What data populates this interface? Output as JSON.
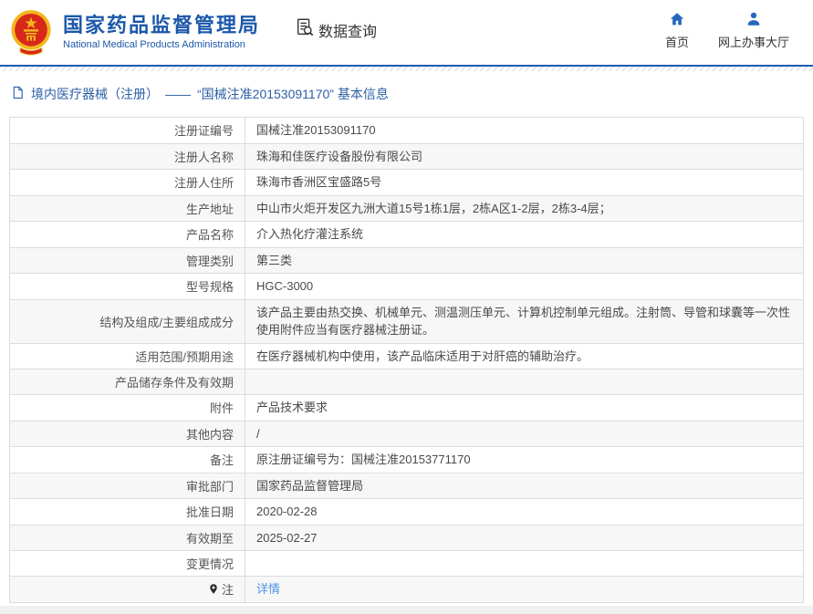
{
  "colors": {
    "brand_blue": "#1c58aa",
    "divider_blue": "#1d5ab0",
    "breadcrumb_blue": "#2b5fa5",
    "link_blue": "#4f94e3",
    "row_alt": "#f7f7f7",
    "border": "#dcdcdc",
    "emblem_red": "#d7281a",
    "emblem_gold": "#f2b71e"
  },
  "icons": {
    "brand": "national-emblem-icon",
    "query": "document-search-icon",
    "home": "home-icon",
    "hall": "person-icon",
    "breadcrumb": "document-icon",
    "note": "location-pin-icon"
  },
  "header": {
    "title": "国家药品监督管理局",
    "subtitle": "National Medical Products Administration",
    "nav_data_query": "数据查询",
    "nav_home": "首页",
    "nav_hall": "网上办事大厅"
  },
  "breadcrumb": {
    "category": "境内医疗器械（注册）",
    "separator": "——",
    "detail": "“国械注准20153091170” 基本信息"
  },
  "table": {
    "rows": [
      {
        "label": "注册证编号",
        "value": "国械注准20153091170"
      },
      {
        "label": "注册人名称",
        "value": "珠海和佳医疗设备股份有限公司"
      },
      {
        "label": "注册人住所",
        "value": "珠海市香洲区宝盛路5号"
      },
      {
        "label": "生产地址",
        "value": "中山市火炬开发区九洲大道15号1栋1层，2栋A区1-2层，2栋3-4层；"
      },
      {
        "label": "产品名称",
        "value": "介入热化疗灌注系统"
      },
      {
        "label": "管理类别",
        "value": "第三类"
      },
      {
        "label": "型号规格",
        "value": "HGC-3000"
      },
      {
        "label": "结构及组成/主要组成成分",
        "value": "该产品主要由热交换、机械单元、测温测压单元、计算机控制单元组成。注射筒、导管和球囊等一次性使用附件应当有医疗器械注册证。"
      },
      {
        "label": "适用范围/预期用途",
        "value": "在医疗器械机构中使用，该产品临床适用于对肝癌的辅助治疗。"
      },
      {
        "label": "产品储存条件及有效期",
        "value": ""
      },
      {
        "label": "附件",
        "value": "产品技术要求"
      },
      {
        "label": "其他内容",
        "value": "/"
      },
      {
        "label": "备注",
        "value": "原注册证编号为：国械注准20153771170"
      },
      {
        "label": "审批部门",
        "value": "国家药品监督管理局"
      },
      {
        "label": "批准日期",
        "value": "2020-02-28"
      },
      {
        "label": "有效期至",
        "value": "2025-02-27"
      },
      {
        "label": "变更情况",
        "value": ""
      },
      {
        "label": "注",
        "value": "详情",
        "link": true,
        "pin_icon": true
      }
    ]
  }
}
